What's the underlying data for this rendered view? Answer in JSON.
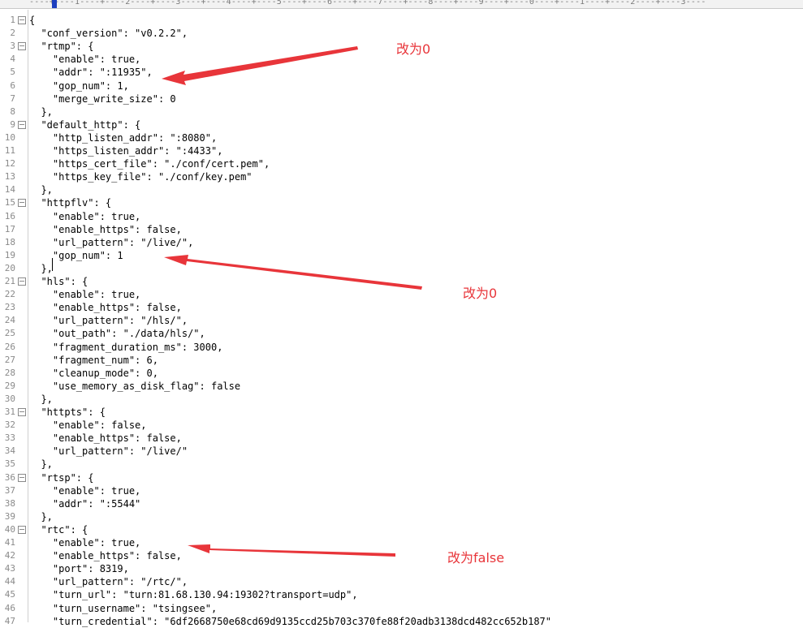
{
  "ruler": {
    "text": "----+----1----+----2----+----3----+----4----+----5----+----6----+----7----+----8----+----9----+----0----+----1----+----2----+----3----"
  },
  "lines": [
    {
      "n": "1",
      "fold": true,
      "text": "{"
    },
    {
      "n": "2",
      "fold": false,
      "text": "  \"conf_version\": \"v0.2.2\","
    },
    {
      "n": "3",
      "fold": true,
      "text": "  \"rtmp\": {"
    },
    {
      "n": "4",
      "fold": false,
      "text": "    \"enable\": true,"
    },
    {
      "n": "5",
      "fold": false,
      "text": "    \"addr\": \":11935\","
    },
    {
      "n": "6",
      "fold": false,
      "text": "    \"gop_num\": 1,"
    },
    {
      "n": "7",
      "fold": false,
      "text": "    \"merge_write_size\": 0"
    },
    {
      "n": "8",
      "fold": false,
      "text": "  },"
    },
    {
      "n": "9",
      "fold": true,
      "text": "  \"default_http\": {"
    },
    {
      "n": "10",
      "fold": false,
      "text": "    \"http_listen_addr\": \":8080\","
    },
    {
      "n": "11",
      "fold": false,
      "text": "    \"https_listen_addr\": \":4433\","
    },
    {
      "n": "12",
      "fold": false,
      "text": "    \"https_cert_file\": \"./conf/cert.pem\","
    },
    {
      "n": "13",
      "fold": false,
      "text": "    \"https_key_file\": \"./conf/key.pem\""
    },
    {
      "n": "14",
      "fold": false,
      "text": "  },"
    },
    {
      "n": "15",
      "fold": true,
      "text": "  \"httpflv\": {"
    },
    {
      "n": "16",
      "fold": false,
      "text": "    \"enable\": true,"
    },
    {
      "n": "17",
      "fold": false,
      "text": "    \"enable_https\": false,"
    },
    {
      "n": "18",
      "fold": false,
      "text": "    \"url_pattern\": \"/live/\","
    },
    {
      "n": "19",
      "fold": false,
      "text": "    \"gop_num\": 1"
    },
    {
      "n": "20",
      "fold": false,
      "text": "  },"
    },
    {
      "n": "21",
      "fold": true,
      "text": "  \"hls\": {"
    },
    {
      "n": "22",
      "fold": false,
      "text": "    \"enable\": true,"
    },
    {
      "n": "23",
      "fold": false,
      "text": "    \"enable_https\": false,"
    },
    {
      "n": "24",
      "fold": false,
      "text": "    \"url_pattern\": \"/hls/\","
    },
    {
      "n": "25",
      "fold": false,
      "text": "    \"out_path\": \"./data/hls/\","
    },
    {
      "n": "26",
      "fold": false,
      "text": "    \"fragment_duration_ms\": 3000,"
    },
    {
      "n": "27",
      "fold": false,
      "text": "    \"fragment_num\": 6,"
    },
    {
      "n": "28",
      "fold": false,
      "text": "    \"cleanup_mode\": 0,"
    },
    {
      "n": "29",
      "fold": false,
      "text": "    \"use_memory_as_disk_flag\": false"
    },
    {
      "n": "30",
      "fold": false,
      "text": "  },"
    },
    {
      "n": "31",
      "fold": true,
      "text": "  \"httpts\": {"
    },
    {
      "n": "32",
      "fold": false,
      "text": "    \"enable\": false,"
    },
    {
      "n": "33",
      "fold": false,
      "text": "    \"enable_https\": false,"
    },
    {
      "n": "34",
      "fold": false,
      "text": "    \"url_pattern\": \"/live/\""
    },
    {
      "n": "35",
      "fold": false,
      "text": "  },"
    },
    {
      "n": "36",
      "fold": true,
      "text": "  \"rtsp\": {"
    },
    {
      "n": "37",
      "fold": false,
      "text": "    \"enable\": true,"
    },
    {
      "n": "38",
      "fold": false,
      "text": "    \"addr\": \":5544\""
    },
    {
      "n": "39",
      "fold": false,
      "text": "  },"
    },
    {
      "n": "40",
      "fold": true,
      "text": "  \"rtc\": {"
    },
    {
      "n": "41",
      "fold": false,
      "text": "    \"enable\": true,"
    },
    {
      "n": "42",
      "fold": false,
      "text": "    \"enable_https\": false,"
    },
    {
      "n": "43",
      "fold": false,
      "text": "    \"port\": 8319,"
    },
    {
      "n": "44",
      "fold": false,
      "text": "    \"url_pattern\": \"/rtc/\","
    },
    {
      "n": "45",
      "fold": false,
      "text": "    \"turn_url\": \"turn:81.68.130.94:19302?transport=udp\","
    },
    {
      "n": "46",
      "fold": false,
      "text": "    \"turn_username\": \"tsingsee\","
    },
    {
      "n": "47",
      "fold": false,
      "text": "    \"turn_credential\": \"6df2668750e68cd69d9135ccd25b703c370fe88f20adb3138dcd482cc652b187\""
    }
  ],
  "annotations": {
    "note1": "改为0",
    "note2": "改为0",
    "note3": "改为false",
    "color": "#e8353a"
  }
}
